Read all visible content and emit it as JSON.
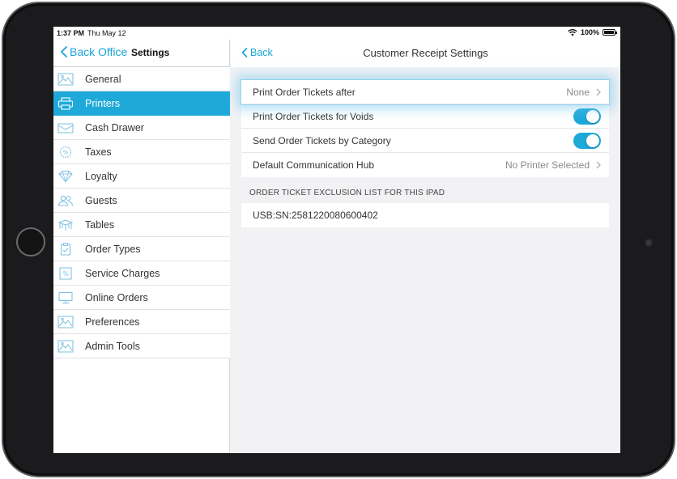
{
  "status": {
    "time": "1:37 PM",
    "date": "Thu May 12",
    "battery": "100%"
  },
  "sidebar": {
    "back_label": "Back Office",
    "title": "Settings",
    "items": [
      {
        "label": "General",
        "icon": "landscape-icon",
        "active": false
      },
      {
        "label": "Printers",
        "icon": "printer-icon",
        "active": true
      },
      {
        "label": "Cash Drawer",
        "icon": "cash-drawer-icon",
        "active": false
      },
      {
        "label": "Taxes",
        "icon": "percent-badge-icon",
        "active": false
      },
      {
        "label": "Loyalty",
        "icon": "diamond-icon",
        "active": false
      },
      {
        "label": "Guests",
        "icon": "guests-icon",
        "active": false
      },
      {
        "label": "Tables",
        "icon": "table-icon",
        "active": false
      },
      {
        "label": "Order Types",
        "icon": "clipboard-icon",
        "active": false
      },
      {
        "label": "Service Charges",
        "icon": "percent-square-icon",
        "active": false
      },
      {
        "label": "Online Orders",
        "icon": "monitor-icon",
        "active": false
      },
      {
        "label": "Preferences",
        "icon": "landscape-icon",
        "active": false
      },
      {
        "label": "Admin Tools",
        "icon": "landscape-icon",
        "active": false
      }
    ]
  },
  "main": {
    "back_label": "Back",
    "title": "Customer Receipt Settings",
    "rows": {
      "print_after": {
        "label": "Print Order Tickets after",
        "value": "None"
      },
      "voids": {
        "label": "Print Order Tickets for Voids",
        "on": true
      },
      "by_category": {
        "label": "Send Order Tickets by Category",
        "on": true
      },
      "comm_hub": {
        "label": "Default Communication Hub",
        "value": "No Printer Selected"
      }
    },
    "exclusion_section": "ORDER TICKET EXCLUSION LIST FOR THIS IPAD",
    "exclusion_items": [
      "USB:SN:2581220080600402"
    ]
  },
  "colors": {
    "accent": "#1ea9d9",
    "link": "#1aa5d6",
    "background": "#f2f2f4"
  }
}
